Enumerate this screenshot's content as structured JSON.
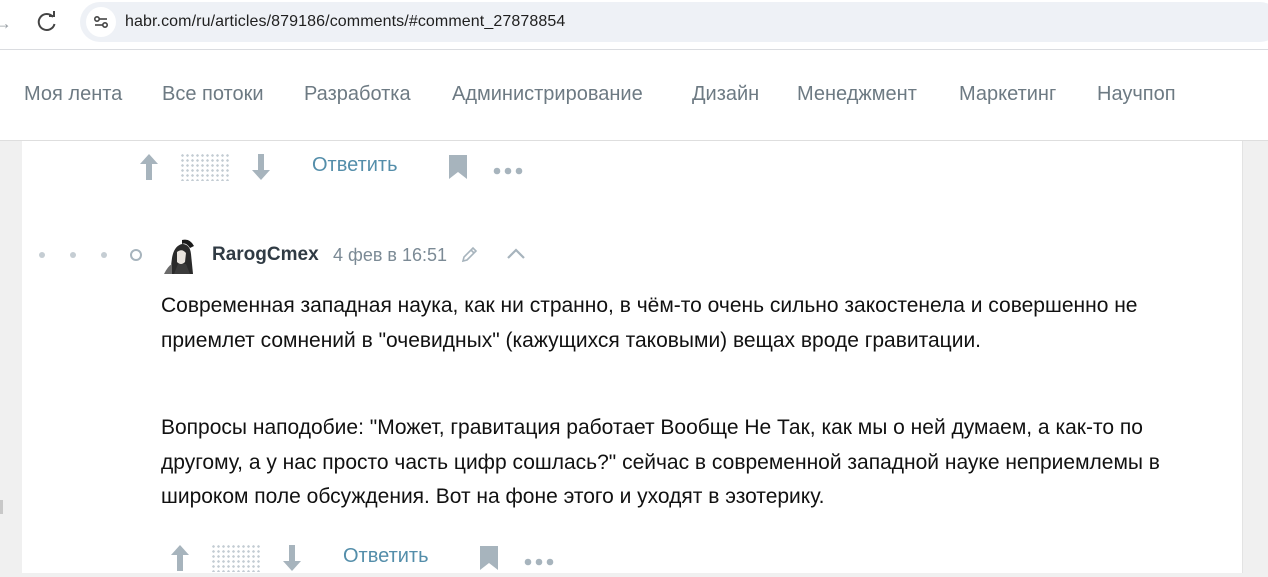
{
  "browser": {
    "url": "habr.com/ru/articles/879186/comments/#comment_27878854"
  },
  "nav": {
    "items": [
      "Моя лента",
      "Все потоки",
      "Разработка",
      "Администрирование",
      "Дизайн",
      "Менеджмент",
      "Маркетинг",
      "Научпоп"
    ]
  },
  "prev_comment": {
    "reply_label": "Ответить"
  },
  "comment": {
    "username": "RarogCmex",
    "timestamp": "4 фев в 16:51",
    "paragraphs": [
      "Современная западная наука, как ни странно, в чём-то очень сильно закостенела и совершенно не приемлет сомнений в \"очевидных\" (кажущихся таковыми) вещах вроде гравитации.",
      "Вопросы наподобие: \"Может, гравитация работает Вообще Не Так, как мы о ней думаем, а как-то по другому, а у нас просто часть цифр сошлась?\" сейчас в современной западной науке неприемлемы в широком поле обсуждения. Вот на фоне этого и уходят в эзотерику."
    ],
    "reply_label": "Ответить"
  },
  "icons": {
    "upvote": "arrow-up-icon",
    "downvote": "arrow-down-icon",
    "bookmark": "bookmark-icon",
    "more": "more-dots-icon",
    "edit": "pencil-icon",
    "collapse": "chevron-up-icon",
    "reload": "reload-icon",
    "site_info": "tune-icon"
  },
  "colors": {
    "link": "#548eaa",
    "icon_muted": "#a7b4bd",
    "nav_text": "#6d7a83"
  }
}
